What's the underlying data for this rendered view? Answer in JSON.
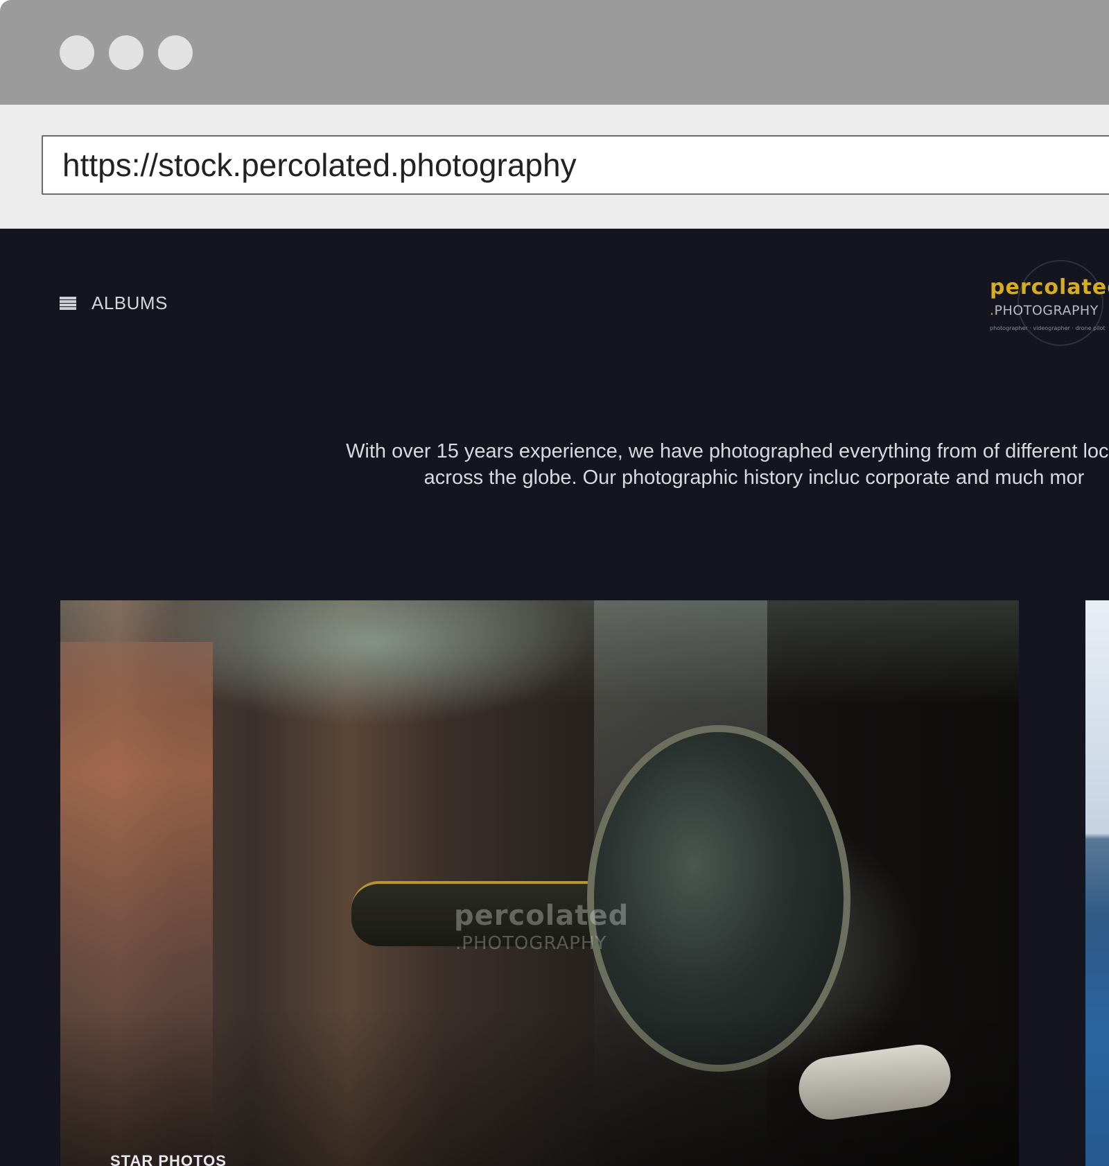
{
  "browser": {
    "url": "https://stock.percolated.photography"
  },
  "header": {
    "albums_label": "ALBUMS"
  },
  "logo": {
    "title": "percolated",
    "subtitle_dot": ".",
    "subtitle": "PHOTOGRAPHY",
    "tagline": "photographer · videographer · drone pilot"
  },
  "intro": {
    "text": "With over 15 years experience, we have photographed everything from of different locations across the globe. Our photographic history incluc corporate and much mor"
  },
  "albums": [
    {
      "label": "STAR PHOTOS",
      "watermark_title": "percolated",
      "watermark_sub": ".PHOTOGRAPHY"
    }
  ],
  "colors": {
    "page_background": "#15151f",
    "brand_gold": "#d7ad1f",
    "titlebar": "#9b9b9b",
    "addressbar": "#ececec"
  }
}
